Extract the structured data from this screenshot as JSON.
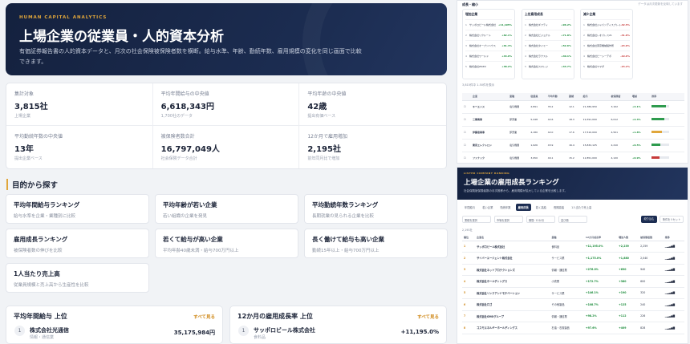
{
  "hero": {
    "kicker": "HUMAN CAPITAL ANALYTICS",
    "title": "上場企業の従業員・人的資本分析",
    "description": "有価証券報告書の人的資本データと、月次の社会保険被保険者数を横断。給与水準、年齢、勤続年数、雇用規模の変化を同じ画面で比較できます。"
  },
  "stats": [
    {
      "label": "集計対象",
      "value": "3,815社",
      "sub": "上場企業"
    },
    {
      "label": "平均年間給与の中央値",
      "value": "6,618,343円",
      "sub": "1,700社のデータ"
    },
    {
      "label": "平均年齢の中央値",
      "value": "42歳",
      "sub": "提出有価ベース"
    },
    {
      "label": "平均勤続年数の中央値",
      "value": "13年",
      "sub": "提出企業ベース"
    },
    {
      "label": "被保険者数合計",
      "value": "16,797,049人",
      "sub": "社会保険データ合計"
    },
    {
      "label": "12か月で雇用増加",
      "value": "2,195社",
      "sub": "前年同月比で増加"
    }
  ],
  "purpose_section": {
    "title": "目的から探す"
  },
  "purposes": [
    {
      "title": "平均年間給与ランキング",
      "desc": "給与水準を企業・業種別に比較"
    },
    {
      "title": "平均年齢が若い企業",
      "desc": "若い組織の企業を発見"
    },
    {
      "title": "平均勤続年数ランキング",
      "desc": "長期就業の見られる企業を比較"
    },
    {
      "title": "雇用成長ランキング",
      "desc": "被保険者数の伸びを比較"
    },
    {
      "title": "若くて給与が高い企業",
      "desc": "平均年齢40歳未満・給与700万円以上"
    },
    {
      "title": "長く働けて給与も高い企業",
      "desc": "勤続15年以上・給与700万円以上"
    },
    {
      "title": "1人当たり売上高",
      "desc": "従業員規模と売上高から生産性を比較"
    }
  ],
  "rankings": [
    {
      "title": "平均年間給与 上位",
      "more": "すべて見る",
      "rank": "1",
      "company": "株式会社光通信",
      "industry": "情報・通信業",
      "value": "35,175,984円"
    },
    {
      "title": "12か月の雇用成長率 上位",
      "more": "すべて見る",
      "rank": "1",
      "company": "サッポロビール株式会社",
      "industry": "食料品",
      "value": "+11,195.0%"
    }
  ],
  "preview_top": {
    "header": "成長・縮小",
    "note": "データは月次更新を反映しています",
    "minis": [
      {
        "title": "増加企業",
        "rows": [
          {
            "n": "1",
            "t": "サッポロビール株式会社",
            "v": "+11,195%"
          },
          {
            "n": "2",
            "t": "株式会社リクルート",
            "v": "+82.1%"
          },
          {
            "n": "3",
            "t": "株式会社オープンハウス",
            "v": "+61.4%"
          },
          {
            "n": "4",
            "t": "株式会社ワールド",
            "v": "+44.9%"
          },
          {
            "n": "5",
            "t": "株式会社ZOZO",
            "v": "+38.2%"
          }
        ]
      },
      {
        "title": "上位雇用成長",
        "rows": [
          {
            "n": "1",
            "t": "株式会社ギフティ",
            "v": "+96.2%"
          },
          {
            "n": "2",
            "t": "株式会社ビジョナル",
            "v": "+71.8%"
          },
          {
            "n": "3",
            "t": "株式会社タイミー",
            "v": "+52.6%"
          },
          {
            "n": "4",
            "t": "株式会社ラクスル",
            "v": "+40.1%"
          },
          {
            "n": "5",
            "t": "株式会社スマレジ",
            "v": "+33.7%"
          }
        ]
      },
      {
        "title": "減少企業",
        "rows": [
          {
            "n": "1",
            "t": "株式会社ジャパンディスプレイ",
            "v": "-42.5%"
          },
          {
            "n": "2",
            "t": "株式会社レオパレス21",
            "v": "-31.8%"
          },
          {
            "n": "3",
            "t": "株式会社東京機械製作所",
            "v": "-24.0%"
          },
          {
            "n": "4",
            "t": "株式会社ピーシーデポ",
            "v": "-19.6%"
          },
          {
            "n": "5",
            "t": "株式会社ヤマダ",
            "v": "-15.2%"
          }
        ]
      }
    ],
    "table_label": "3,815件中 1-50件を表示",
    "columns": [
      "",
      "企業",
      "業種",
      "従業員",
      "平均年齢",
      "勤続",
      "給与",
      "被保険者",
      "増減",
      "推移"
    ],
    "rows": [
      {
        "name": "キーエンス",
        "ind": "電気機器",
        "emp": "2,891",
        "age": "35.2",
        "ten": "12.1",
        "sal": "21,389,950",
        "ins": "3,102",
        "chg": "+4.1%",
        "fill": 0.8,
        "color": "#2e9b4e"
      },
      {
        "name": "三菱商事",
        "ind": "卸売業",
        "emp": "5,448",
        "age": "42.6",
        "ten": "18.3",
        "sal": "19,391,000",
        "ins": "6,012",
        "chg": "+2.3%",
        "fill": 0.7,
        "color": "#2e9b4e"
      },
      {
        "name": "伊藤忠商事",
        "ind": "卸売業",
        "emp": "4,180",
        "age": "42.0",
        "ten": "17.6",
        "sal": "17,510,000",
        "ins": "4,501",
        "chg": "+1.8%",
        "fill": 0.6,
        "color": "#e0a63b"
      },
      {
        "name": "東京エレクトロン",
        "ind": "電気機器",
        "emp": "1,926",
        "age": "43.9",
        "ten": "16.4",
        "sal": "15,832,125",
        "ins": "2,210",
        "chg": "+6.5%",
        "fill": 0.5,
        "color": "#2e9b4e"
      },
      {
        "name": "ファナック",
        "ind": "電気機器",
        "emp": "3,950",
        "age": "40.1",
        "ten": "15.2",
        "sal": "12,851,000",
        "ins": "4,120",
        "chg": "+0.9%",
        "fill": 0.45,
        "color": "#c73a3a"
      }
    ]
  },
  "preview_bottom": {
    "kicker": "LISTED COMPANY RANKING",
    "title": "上場企業の雇用成長ランキング",
    "desc": "社会保険被保険者数の月次推移から、雇用規模が拡大している企業を比較します。",
    "tabs": [
      "年間給与",
      "若い企業",
      "勤続年数",
      "雇用成長",
      "若く高給",
      "長期高給",
      "1人当たり売上高"
    ],
    "active_tab": 3,
    "filters": [
      "業種を選択",
      "市場を選択",
      "期間: 12か月",
      "並び順"
    ],
    "apply": "絞り込む",
    "reset": "条件をリセット",
    "count": "2,195社",
    "columns": [
      "順位",
      "企業名",
      "業種",
      "12か月成長率",
      "増加人数",
      "被保険者数",
      "推移"
    ],
    "rows": [
      {
        "rk": "1",
        "co": "サッポロビール株式会社",
        "ind": "食料品",
        "rate": "+11,195.0%",
        "inc": "+2,239",
        "ins": "2,259"
      },
      {
        "rk": "2",
        "co": "サイバーエージェント株式会社",
        "ind": "サービス業",
        "rate": "+1,175.0%",
        "inc": "+1,880",
        "ins": "2,040"
      },
      {
        "rk": "3",
        "co": "株式会社ネットプロテクションズ",
        "ind": "情報・通信業",
        "rate": "+276.0%",
        "inc": "+690",
        "ins": "940"
      },
      {
        "rk": "4",
        "co": "株式会社ホールディングス",
        "ind": "小売業",
        "rate": "+172.7%",
        "inc": "+380",
        "ins": "600"
      },
      {
        "rk": "5",
        "co": "株式会社リンクアンドモチベーション",
        "ind": "サービス業",
        "rate": "+146.1%",
        "inc": "+190",
        "ins": "320"
      },
      {
        "rk": "6",
        "co": "株式会社ロゴ",
        "ind": "その他製品",
        "rate": "+108.7%",
        "inc": "+125",
        "ins": "240"
      },
      {
        "rk": "7",
        "co": "株式会社GMOグループ",
        "ind": "情報・通信業",
        "rate": "+98.2%",
        "inc": "+112",
        "ins": "226"
      },
      {
        "rk": "8",
        "co": "コスモエネルギーホールディングス",
        "ind": "石油・石炭製品",
        "rate": "+97.6%",
        "inc": "+409",
        "ins": "828"
      }
    ]
  }
}
